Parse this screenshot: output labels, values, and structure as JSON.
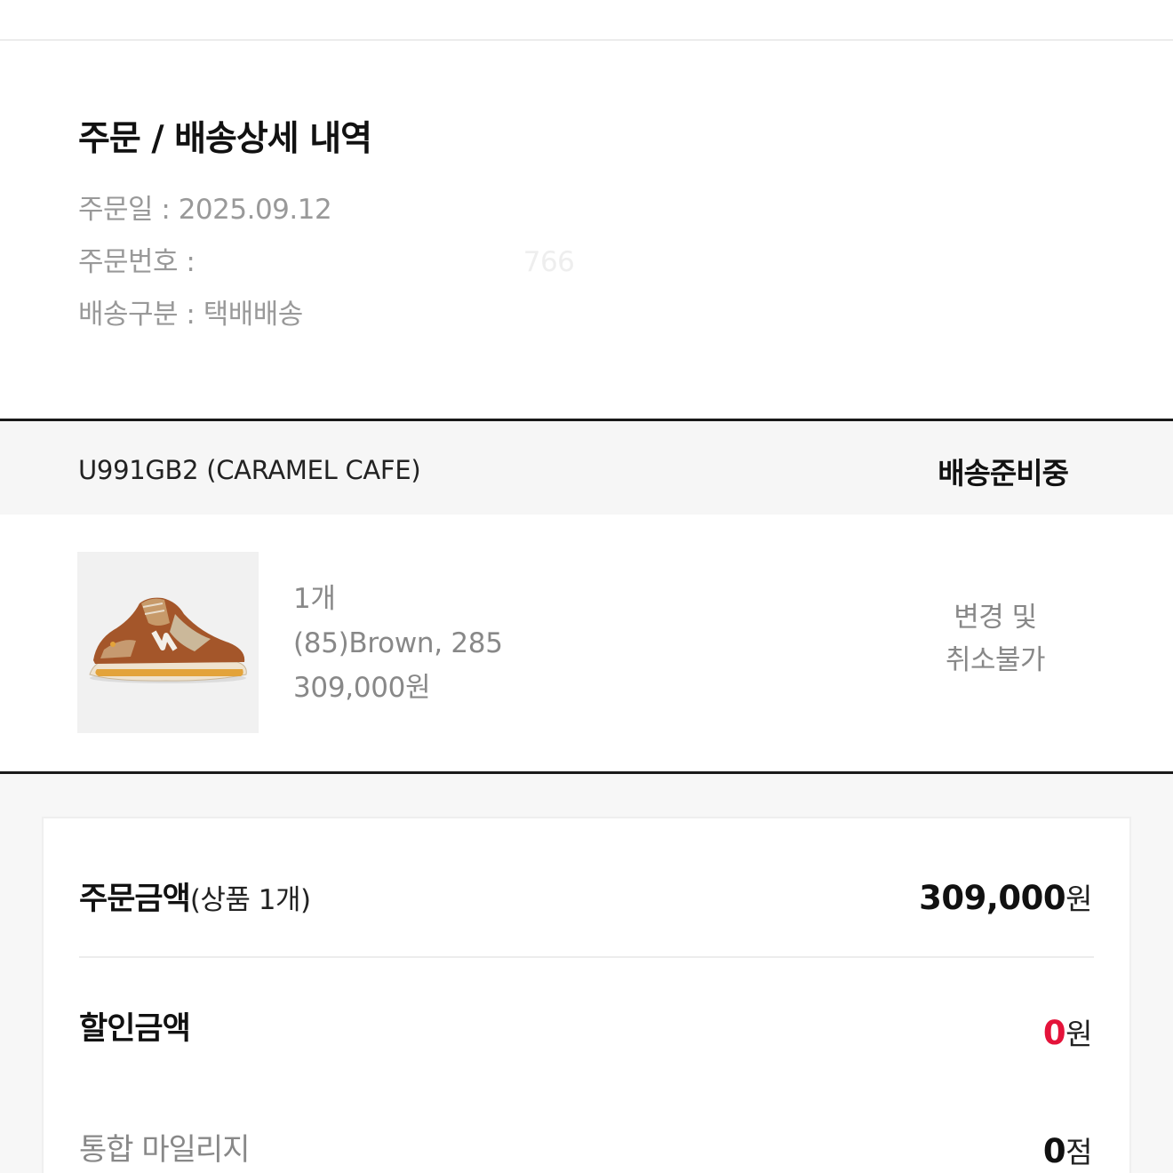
{
  "order": {
    "title": "주문 / 배송상세 내역",
    "date_label": "주문일 : 2025.09.12",
    "number_prefix": "주문번호 : ",
    "number_visible_tail": "766",
    "delivery_label": "배송구분 : 택배배송"
  },
  "item": {
    "name": "U991GB2 (CARAMEL CAFE)",
    "status": "배송준비중",
    "quantity": "1개",
    "option": "(85)Brown, 285",
    "price": "309,000원",
    "note_line1": "변경 및",
    "note_line2": "취소불가",
    "image_icon": "sneaker-image"
  },
  "summary": {
    "order_amount_label": "주문금액",
    "order_amount_sub": "(상품 1개)",
    "order_amount_value": "309,000",
    "order_amount_unit": "원",
    "discount_label": "할인금액",
    "discount_value": "0",
    "discount_unit": "원",
    "mileage_label": "통합 마일리지",
    "mileage_value": "0",
    "mileage_unit": "점"
  },
  "colors": {
    "accent_red": "#e4133a",
    "muted_text": "#888888",
    "divider_dark": "#1a1a1a"
  }
}
